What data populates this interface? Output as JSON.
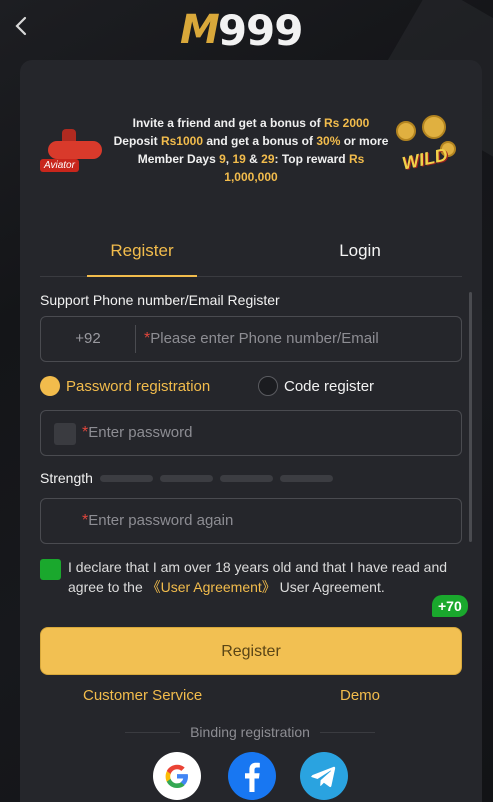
{
  "header": {
    "back_icon": "chevron-left-icon",
    "logo_m": "M",
    "logo_num": "999"
  },
  "promo": {
    "aviator_tag": "Aviator",
    "wild_text": "WILD",
    "line1_a": "Invite a friend and get a bonus of ",
    "line1_b": "Rs 2000",
    "line2_a": "Deposit ",
    "line2_b": "Rs1000",
    "line2_c": " and get a bonus of ",
    "line2_d": "30%",
    "line2_e": " or more",
    "line3_a": "Member Days ",
    "line3_b": "9",
    "line3_c": ", ",
    "line3_d": "19",
    "line3_e": " & ",
    "line3_f": "29",
    "line3_g": ": Top reward ",
    "line3_h": "Rs 1,000,000"
  },
  "tabs": {
    "register": "Register",
    "login": "Login"
  },
  "form": {
    "section_label": "Support Phone number/Email Register",
    "country_code": "+92",
    "phone_placeholder": "Please enter Phone number/Email",
    "required_mark": "*",
    "radio_password": "Password registration",
    "radio_code": "Code register",
    "password_placeholder": "Enter password",
    "strength_label": "Strength",
    "password_again_placeholder": "Enter password again",
    "agree_a": "I declare that I am over 18 years old and that I have read and agree to the ",
    "agree_link": "《User Agreement》",
    "agree_b": " User Agreement.",
    "bonus_badge": "+70",
    "submit": "Register"
  },
  "links": {
    "customer_service": "Customer Service",
    "demo": "Demo",
    "binding": "Binding registration"
  },
  "social": {
    "google_icon": "google-icon",
    "facebook_icon": "facebook-icon",
    "telegram_icon": "telegram-icon"
  },
  "colors": {
    "accent": "#f2bc4c",
    "background": "#141518",
    "card": "#25262b",
    "check_green": "#1aa82d",
    "required_red": "#e0463c"
  }
}
